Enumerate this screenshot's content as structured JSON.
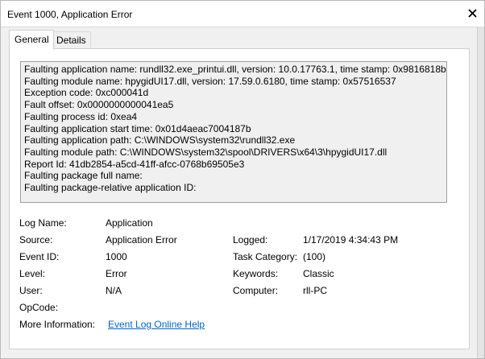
{
  "window": {
    "title": "Event 1000, Application Error"
  },
  "tabs": [
    {
      "label": "General",
      "active": true
    },
    {
      "label": "Details",
      "active": false
    }
  ],
  "description_lines": [
    "Faulting application name: rundll32.exe_printui.dll, version: 10.0.17763.1, time stamp: 0x9816818b",
    "Faulting module name: hpygidUI17.dll, version: 17.59.0.6180, time stamp: 0x57516537",
    "Exception code: 0xc000041d",
    "Fault offset: 0x0000000000041ea5",
    "Faulting process id: 0xea4",
    "Faulting application start time: 0x01d4aeac7004187b",
    "Faulting application path: C:\\WINDOWS\\system32\\rundll32.exe",
    "Faulting module path: C:\\WINDOWS\\system32\\spool\\DRIVERS\\x64\\3\\hpygidUI17.dll",
    "Report Id: 41db2854-a5cd-41ff-afcc-0768b69505e3",
    "Faulting package full name:",
    "Faulting package-relative application ID:"
  ],
  "fields": {
    "log_name": {
      "label": "Log Name:",
      "value": "Application"
    },
    "source": {
      "label": "Source:",
      "value": "Application Error"
    },
    "logged": {
      "label": "Logged:",
      "value": "1/17/2019 4:34:43 PM"
    },
    "event_id": {
      "label": "Event ID:",
      "value": "1000"
    },
    "task_category": {
      "label": "Task Category:",
      "value": "(100)"
    },
    "level": {
      "label": "Level:",
      "value": "Error"
    },
    "keywords": {
      "label": "Keywords:",
      "value": "Classic"
    },
    "user": {
      "label": "User:",
      "value": "N/A"
    },
    "computer": {
      "label": "Computer:",
      "value": "rll-PC"
    },
    "opcode": {
      "label": "OpCode:",
      "value": ""
    },
    "more_info": {
      "label": "More Information:",
      "link_text": "Event Log Online Help"
    }
  },
  "icons": {
    "close": "close-icon"
  },
  "colors": {
    "link": "#0066cc",
    "window_bg": "#f0f0f0",
    "panel_bg": "#ffffff"
  }
}
